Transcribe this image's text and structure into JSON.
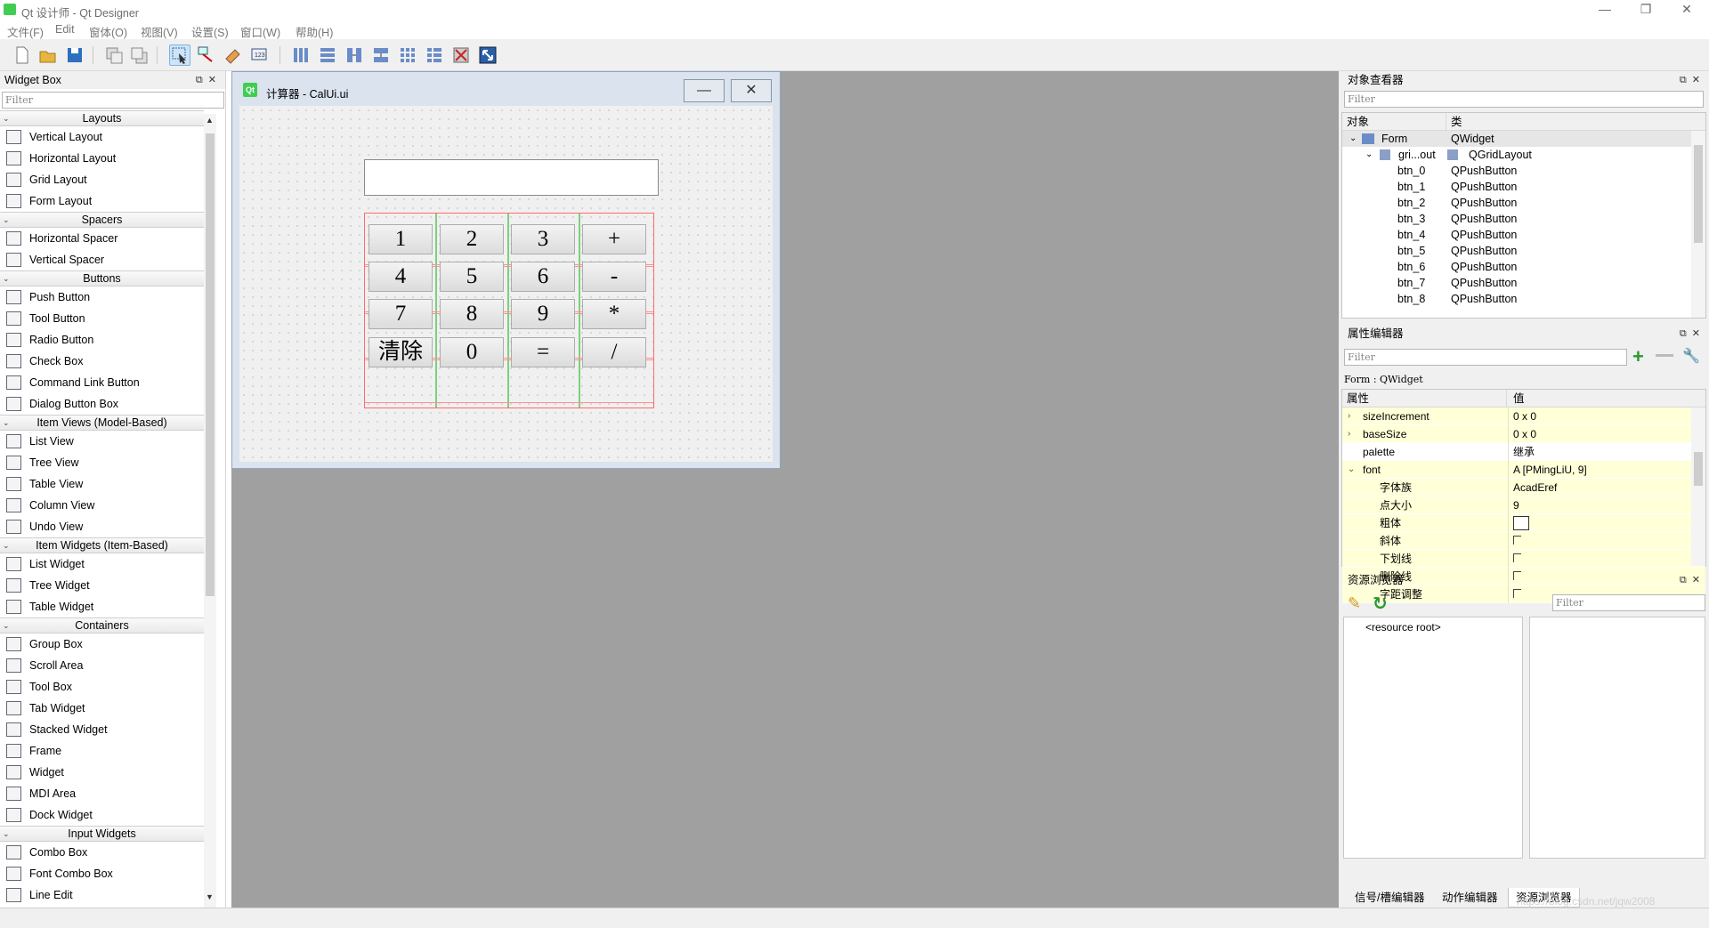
{
  "window": {
    "title": "Qt 设计师 - Qt Designer",
    "minimize": "—",
    "restore": "❐",
    "close": "✕"
  },
  "menu": [
    "文件(F)",
    "Edit",
    "窗体(O)",
    "视图(V)",
    "设置(S)",
    "窗口(W)",
    "帮助(H)"
  ],
  "widget_box": {
    "title": "Widget Box",
    "filter_placeholder": "Filter",
    "categories": [
      {
        "name": "Layouts",
        "items": [
          "Vertical Layout",
          "Horizontal Layout",
          "Grid Layout",
          "Form Layout"
        ]
      },
      {
        "name": "Spacers",
        "items": [
          "Horizontal Spacer",
          "Vertical Spacer"
        ]
      },
      {
        "name": "Buttons",
        "items": [
          "Push Button",
          "Tool Button",
          "Radio Button",
          "Check Box",
          "Command Link Button",
          "Dialog Button Box"
        ]
      },
      {
        "name": "Item Views (Model-Based)",
        "items": [
          "List View",
          "Tree View",
          "Table View",
          "Column View",
          "Undo View"
        ]
      },
      {
        "name": "Item Widgets (Item-Based)",
        "items": [
          "List Widget",
          "Tree Widget",
          "Table Widget"
        ]
      },
      {
        "name": "Containers",
        "items": [
          "Group Box",
          "Scroll Area",
          "Tool Box",
          "Tab Widget",
          "Stacked Widget",
          "Frame",
          "Widget",
          "MDI Area",
          "Dock Widget"
        ]
      },
      {
        "name": "Input Widgets",
        "items": [
          "Combo Box",
          "Font Combo Box",
          "Line Edit"
        ]
      }
    ]
  },
  "form": {
    "title": "计算器 - CalUi.ui",
    "icon_text": "Qt",
    "keys": [
      [
        "1",
        "2",
        "3",
        "+"
      ],
      [
        "4",
        "5",
        "6",
        "-"
      ],
      [
        "7",
        "8",
        "9",
        "*"
      ],
      [
        "清除",
        "0",
        "=",
        "/"
      ]
    ]
  },
  "object_inspector": {
    "title": "对象查看器",
    "filter_placeholder": "Filter",
    "col_object": "对象",
    "col_class": "类",
    "rows": [
      {
        "name": "Form",
        "cls": "QWidget"
      },
      {
        "name": "gri...out",
        "cls": "QGridLayout"
      },
      {
        "name": "btn_0",
        "cls": "QPushButton"
      },
      {
        "name": "btn_1",
        "cls": "QPushButton"
      },
      {
        "name": "btn_2",
        "cls": "QPushButton"
      },
      {
        "name": "btn_3",
        "cls": "QPushButton"
      },
      {
        "name": "btn_4",
        "cls": "QPushButton"
      },
      {
        "name": "btn_5",
        "cls": "QPushButton"
      },
      {
        "name": "btn_6",
        "cls": "QPushButton"
      },
      {
        "name": "btn_7",
        "cls": "QPushButton"
      },
      {
        "name": "btn_8",
        "cls": "QPushButton"
      }
    ]
  },
  "property_editor": {
    "title": "属性编辑器",
    "filter_placeholder": "Filter",
    "context": "Form : QWidget",
    "col_prop": "属性",
    "col_val": "值",
    "rows": [
      {
        "name": "sizeIncrement",
        "value": "0 x 0"
      },
      {
        "name": "baseSize",
        "value": "0 x 0"
      },
      {
        "name": "palette",
        "value": "继承"
      },
      {
        "name": "font",
        "value": "A  [PMingLiU, 9]"
      },
      {
        "name": "字体族",
        "value": "AcadEref"
      },
      {
        "name": "点大小",
        "value": "9"
      },
      {
        "name": "粗体",
        "value": ""
      },
      {
        "name": "斜体",
        "value": ""
      },
      {
        "name": "下划线",
        "value": ""
      },
      {
        "name": "删除线",
        "value": ""
      },
      {
        "name": "字距调整",
        "value": ""
      }
    ]
  },
  "resource_browser": {
    "title": "资源浏览器",
    "filter_placeholder": "Filter",
    "root": "<resource root>"
  },
  "bottom_tabs": [
    "信号/槽编辑器",
    "动作编辑器",
    "资源浏览器"
  ],
  "watermark": "https://blog.csdn.net/jqw2008"
}
